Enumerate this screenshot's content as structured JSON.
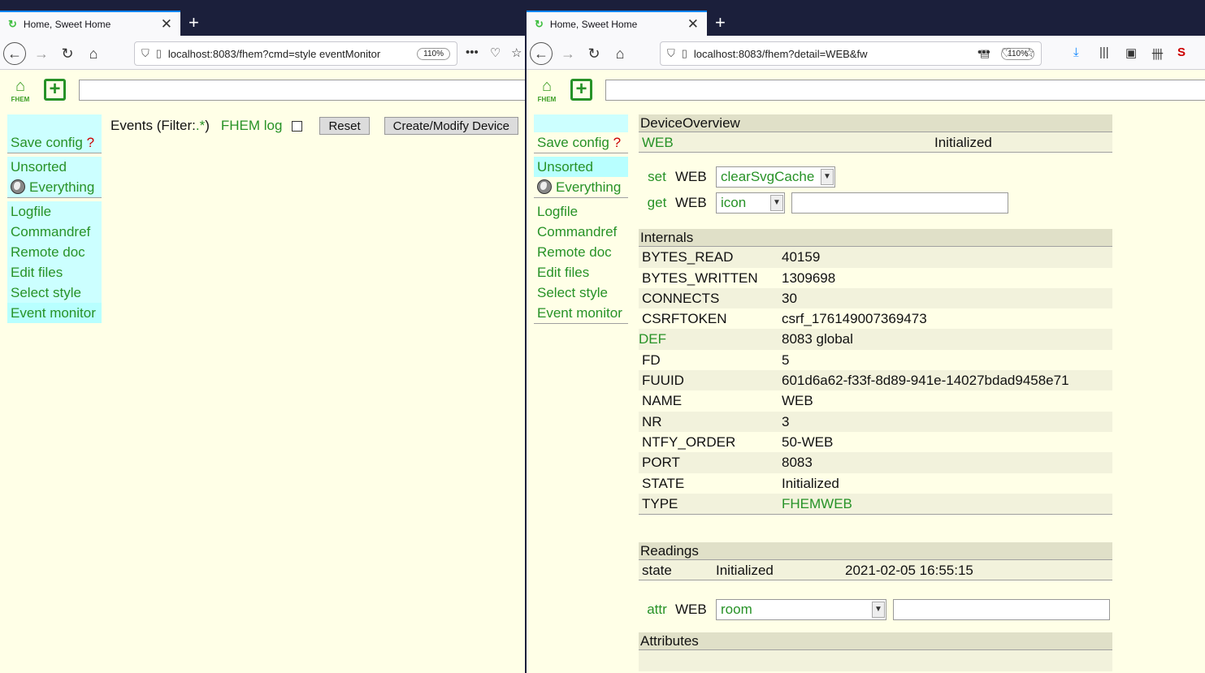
{
  "left": {
    "tab": {
      "title": "Home, Sweet Home"
    },
    "url": "localhost:8083/fhem?cmd=style eventMonitor",
    "zoom": "110%",
    "logo_text": "FHEM",
    "menu": {
      "save": "Save config",
      "q": "?",
      "unsorted": "Unsorted",
      "everything": "Everything",
      "links": [
        "Logfile",
        "Commandref",
        "Remote doc",
        "Edit files",
        "Select style",
        "Event monitor"
      ]
    },
    "events": {
      "label": "Events (Filter: ",
      "filter": ".*",
      "close": ")",
      "fhemlog": "FHEM log",
      "reset": "Reset",
      "create": "Create/Modify Device"
    }
  },
  "right": {
    "tab": {
      "title": "Home, Sweet Home"
    },
    "url": "localhost:8083/fhem?detail=WEB&fw",
    "zoom": "110%",
    "logo_text": "FHEM",
    "menu": {
      "save": "Save config",
      "q": "?",
      "unsorted": "Unsorted",
      "everything": "Everything",
      "links": [
        "Logfile",
        "Commandref",
        "Remote doc",
        "Edit files",
        "Select style",
        "Event monitor"
      ]
    },
    "overview": {
      "header": "DeviceOverview",
      "name": "WEB",
      "state": "Initialized"
    },
    "set": {
      "verb": "set",
      "dev": "WEB",
      "value": "clearSvgCache"
    },
    "get": {
      "verb": "get",
      "dev": "WEB",
      "value": "icon"
    },
    "internals": {
      "header": "Internals",
      "rows": [
        {
          "k": "BYTES_READ",
          "v": "40159"
        },
        {
          "k": "BYTES_WRITTEN",
          "v": "1309698"
        },
        {
          "k": "CONNECTS",
          "v": "30"
        },
        {
          "k": "CSRFTOKEN",
          "v": "csrf_176149007369473"
        },
        {
          "k": "DEF",
          "v": "8083 global"
        },
        {
          "k": "FD",
          "v": "5"
        },
        {
          "k": "FUUID",
          "v": "601d6a62-f33f-8d89-941e-14027bdad9458e71"
        },
        {
          "k": "NAME",
          "v": "WEB"
        },
        {
          "k": "NR",
          "v": "3"
        },
        {
          "k": "NTFY_ORDER",
          "v": "50-WEB"
        },
        {
          "k": "PORT",
          "v": "8083"
        },
        {
          "k": "STATE",
          "v": "Initialized"
        },
        {
          "k": "TYPE",
          "v": "FHEMWEB"
        }
      ]
    },
    "readings": {
      "header": "Readings",
      "name": "state",
      "value": "Initialized",
      "time": "2021-02-05 16:55:15"
    },
    "attr": {
      "verb": "attr",
      "dev": "WEB",
      "value": "room"
    },
    "attributes": {
      "header": "Attributes"
    }
  }
}
